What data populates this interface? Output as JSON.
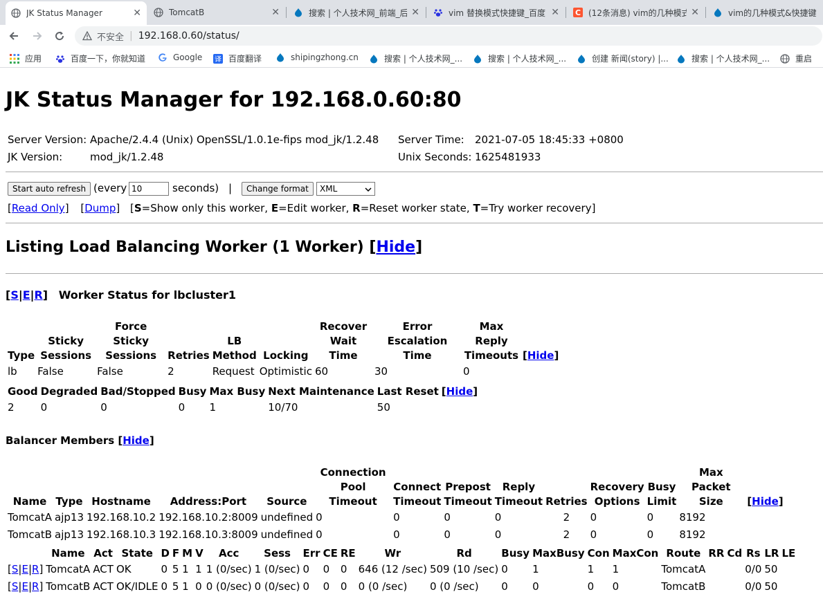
{
  "browser": {
    "tabs": [
      {
        "title": "JK Status Manager",
        "active": true
      },
      {
        "title": "TomcatB"
      },
      {
        "title": "搜索 | 个人技术网_前端_后"
      },
      {
        "title": "vim 替换模式快捷键_百度"
      },
      {
        "title": "(12条消息) vim的几种模式"
      },
      {
        "title": "vim的几种模式&快捷键"
      }
    ],
    "close_glyph": "✕",
    "address": {
      "security": "不安全",
      "url": "192.168.0.60/status/"
    },
    "bookmarks": [
      "应用",
      "百度一下，你就知道",
      "Google",
      "百度翻译",
      "shipingzhong.cn",
      "搜索 | 个人技术网_...",
      "搜索 | 个人技术网_...",
      "创建 新闻(story) |...",
      "搜索 | 个人技术网_...",
      "重启"
    ]
  },
  "page": {
    "title": "JK Status Manager for 192.168.0.60:80",
    "server_version_label": "Server Version:",
    "server_version": "Apache/2.4.4 (Unix) OpenSSL/1.0.1e-fips mod_jk/1.2.48",
    "jk_version_label": "JK Version:",
    "jk_version": "mod_jk/1.2.48",
    "server_time_label": "Server Time:",
    "server_time": "2021-07-05 18:45:33 +0800",
    "unix_seconds_label": "Unix Seconds:",
    "unix_seconds": "1625481933",
    "auto_refresh_button": "Start auto refresh",
    "every_label": "(every",
    "refresh_interval": "10",
    "seconds_label": "seconds)",
    "bar_sep": "|",
    "change_format_button": "Change format",
    "format_selected": "XML",
    "read_only_link": "Read Only",
    "dump_link": "Dump",
    "legend": {
      "s_key": "S",
      "s_text": "=Show only this worker, ",
      "e_key": "E",
      "e_text": "=Edit worker, ",
      "r_key": "R",
      "r_text": "=Reset worker state, ",
      "t_key": "T",
      "t_text": "=Try worker recovery"
    },
    "lb_heading": "Listing Load Balancing Worker (1 Worker)",
    "hide_label": "Hide",
    "worker_links": [
      "S",
      "E",
      "R"
    ],
    "worker_status_title": "Worker Status for lbcluster1",
    "config_table": {
      "headers": [
        "Type",
        "Sticky Sessions",
        "Force Sticky Sessions",
        "Retries",
        "LB Method",
        "Locking",
        "Recover Wait Time",
        "Error Escalation Time",
        "Max Reply Timeouts"
      ],
      "row": [
        "lb",
        "False",
        "False",
        "2",
        "Request",
        "Optimistic",
        "60",
        "30",
        "0"
      ]
    },
    "state_table": {
      "headers": [
        "Good",
        "Degraded",
        "Bad/Stopped",
        "Busy",
        "Max Busy",
        "Next Maintenance",
        "Last Reset"
      ],
      "row": [
        "2",
        "0",
        "0",
        "0",
        "1",
        "10/70",
        "50"
      ]
    },
    "balancer_members_title": "Balancer Members",
    "members_table": {
      "headers": [
        "Name",
        "Type",
        "Hostname",
        "Address:Port",
        "Source",
        "Connection Pool Timeout",
        "Connect Timeout",
        "Prepost Timeout",
        "Reply Timeout",
        "Retries",
        "Recovery Options",
        "Busy Limit",
        "Max Packet Size"
      ],
      "rows": [
        [
          "TomcatA",
          "ajp13",
          "192.168.10.2",
          "192.168.10.2:8009",
          "undefined",
          "0",
          "0",
          "0",
          "0",
          "2",
          "0",
          "0",
          "8192"
        ],
        [
          "TomcatB",
          "ajp13",
          "192.168.10.3",
          "192.168.10.3:8009",
          "undefined",
          "0",
          "0",
          "0",
          "0",
          "2",
          "0",
          "0",
          "8192"
        ]
      ]
    },
    "status_table": {
      "headers": [
        "Name",
        "Act",
        "State",
        "D",
        "F",
        "M",
        "V",
        "Acc",
        "Sess",
        "Err",
        "CE",
        "RE",
        "Wr",
        "Rd",
        "Busy",
        "MaxBusy",
        "Con",
        "MaxCon",
        "Route",
        "RR",
        "Cd",
        "Rs",
        "LR",
        "LE"
      ],
      "rows": [
        [
          "TomcatA",
          "ACT",
          "OK",
          "0",
          "5",
          "1",
          "1",
          "1 (0/sec)",
          "1 (0/sec)",
          "0",
          "0",
          "0",
          "646 (12 /sec)",
          "509 (10 /sec)",
          "0",
          "1",
          "1",
          "1",
          "TomcatA",
          "",
          "",
          "0/0",
          "50",
          ""
        ],
        [
          "TomcatB",
          "ACT",
          "OK/IDLE",
          "0",
          "5",
          "1",
          "0",
          "0 (0/sec)",
          "0 (0/sec)",
          "0",
          "0",
          "0",
          "0 (0 /sec)",
          "0 (0 /sec)",
          "0",
          "0",
          "0",
          "0",
          "TomcatB",
          "",
          "",
          "0/0",
          "50",
          ""
        ]
      ]
    }
  }
}
